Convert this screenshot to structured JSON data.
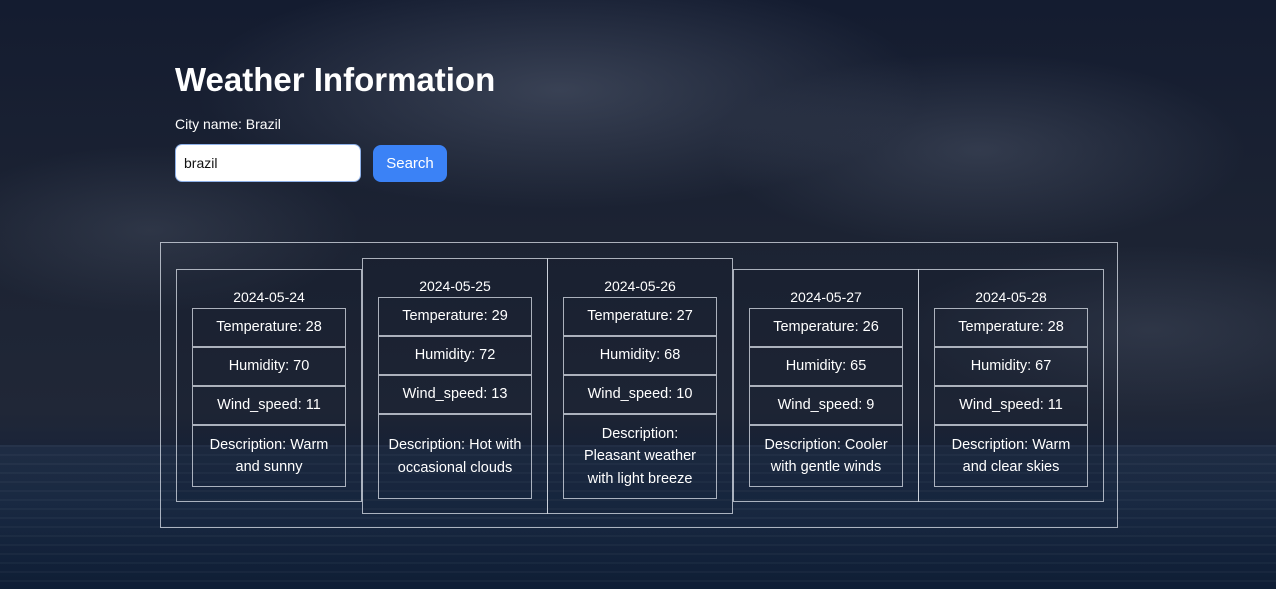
{
  "header": {
    "title": "Weather Information",
    "city_label": "City name: Brazil"
  },
  "search": {
    "value": "brazil",
    "button_label": "Search"
  },
  "colors": {
    "accent": "#3b82f6"
  },
  "days": [
    {
      "date": "2024-05-24",
      "temperature": "Temperature: 28",
      "humidity": "Humidity: 70",
      "wind_speed": "Wind_speed: 11",
      "description": "Description: Warm and sunny"
    },
    {
      "date": "2024-05-25",
      "temperature": "Temperature: 29",
      "humidity": "Humidity: 72",
      "wind_speed": "Wind_speed: 13",
      "description": "Description: Hot with occasional clouds"
    },
    {
      "date": "2024-05-26",
      "temperature": "Temperature: 27",
      "humidity": "Humidity: 68",
      "wind_speed": "Wind_speed: 10",
      "description": "Description: Pleasant weather with light breeze"
    },
    {
      "date": "2024-05-27",
      "temperature": "Temperature: 26",
      "humidity": "Humidity: 65",
      "wind_speed": "Wind_speed: 9",
      "description": "Description: Cooler with gentle winds"
    },
    {
      "date": "2024-05-28",
      "temperature": "Temperature: 28",
      "humidity": "Humidity: 67",
      "wind_speed": "Wind_speed: 11",
      "description": "Description: Warm and clear skies"
    }
  ]
}
